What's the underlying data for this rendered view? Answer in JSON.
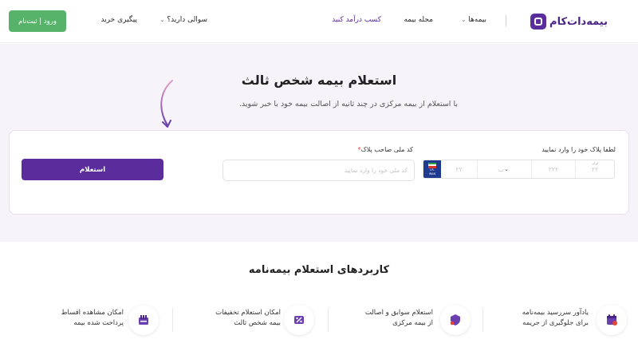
{
  "header": {
    "logo_text": "بیمه‌دات‌کام",
    "nav": [
      {
        "label": "بیمه‌ها",
        "has_dropdown": true
      },
      {
        "label": "مجله بیمه",
        "has_dropdown": false
      },
      {
        "label": "کسب درآمد کنید",
        "has_dropdown": false
      },
      {
        "label": "سوالی دارید؟",
        "has_dropdown": true
      },
      {
        "label": "پیگیری خرید",
        "has_dropdown": false
      }
    ],
    "login_label": "ورود | ثبت‌نام"
  },
  "hero": {
    "title": "استعلام بیمه شخص ثالث",
    "subtitle": "با استعلام از بیمه مرکزی در چند ثانیه از اصالت بیمه خود با خبر شوید."
  },
  "form": {
    "plate_label": "لطفا پلاک خود را وارد نمایید",
    "plate": {
      "region_caption": "ایران",
      "region_placeholder": "۲۲",
      "three_digit_placeholder": "۲۲۲",
      "letter_placeholder": "ب",
      "two_digit_placeholder": "۲۲",
      "flag_text_1": "I.R.",
      "flag_text_2": "IRAN"
    },
    "national_id_label": "کد ملی صاحب پلاک",
    "national_id_placeholder": "کد ملی خود را وارد نمایید",
    "submit_label": "استعلام"
  },
  "applications": {
    "title": "کاربردهای استعلام بیمه‌نامه",
    "items": [
      {
        "line1": "یادآور سررسید بیمه‌نامه",
        "line2": "برای جلوگیری از جریمه",
        "icon": "calendar-icon"
      },
      {
        "line1": "استعلام سوابق و اصالت",
        "line2": "از بیمه مرکزی",
        "icon": "shield-icon"
      },
      {
        "line1": "امکان استعلام تخفیفات",
        "line2": "بیمه شخص ثالث",
        "icon": "discount-icon"
      },
      {
        "line1": "امکان مشاهده اقساط",
        "line2": "پرداخت شده بیمه",
        "icon": "installments-icon"
      }
    ]
  },
  "colors": {
    "brand": "#5b2c9c",
    "login_green": "#57b36a",
    "hero_bg": "#f6f4f9",
    "required_red": "#e0463b"
  }
}
